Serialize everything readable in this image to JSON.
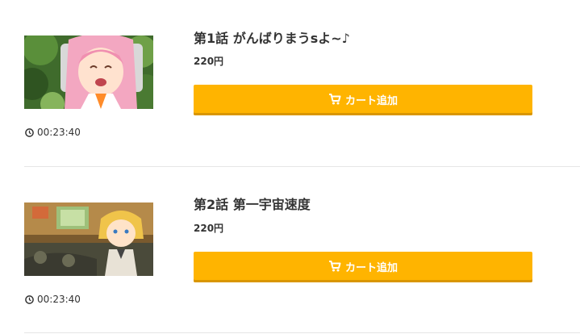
{
  "episodes": [
    {
      "title": "第1話 がんばりまうsよ~♪",
      "price": "220円",
      "cart_label": "カート追加",
      "duration": "00:23:40",
      "thumbnail_icon": "anime-thumbnail-image"
    },
    {
      "title": "第2話 第一宇宙速度",
      "price": "220円",
      "cart_label": "カート追加",
      "duration": "00:23:40",
      "thumbnail_icon": "anime-thumbnail-image"
    }
  ],
  "colors": {
    "cart_button": "#ffb400",
    "cart_button_shadow": "#d99600",
    "text": "#333333",
    "divider": "#e6e6e6"
  },
  "icons": {
    "cart": "cart-icon",
    "clock": "clock-icon"
  }
}
